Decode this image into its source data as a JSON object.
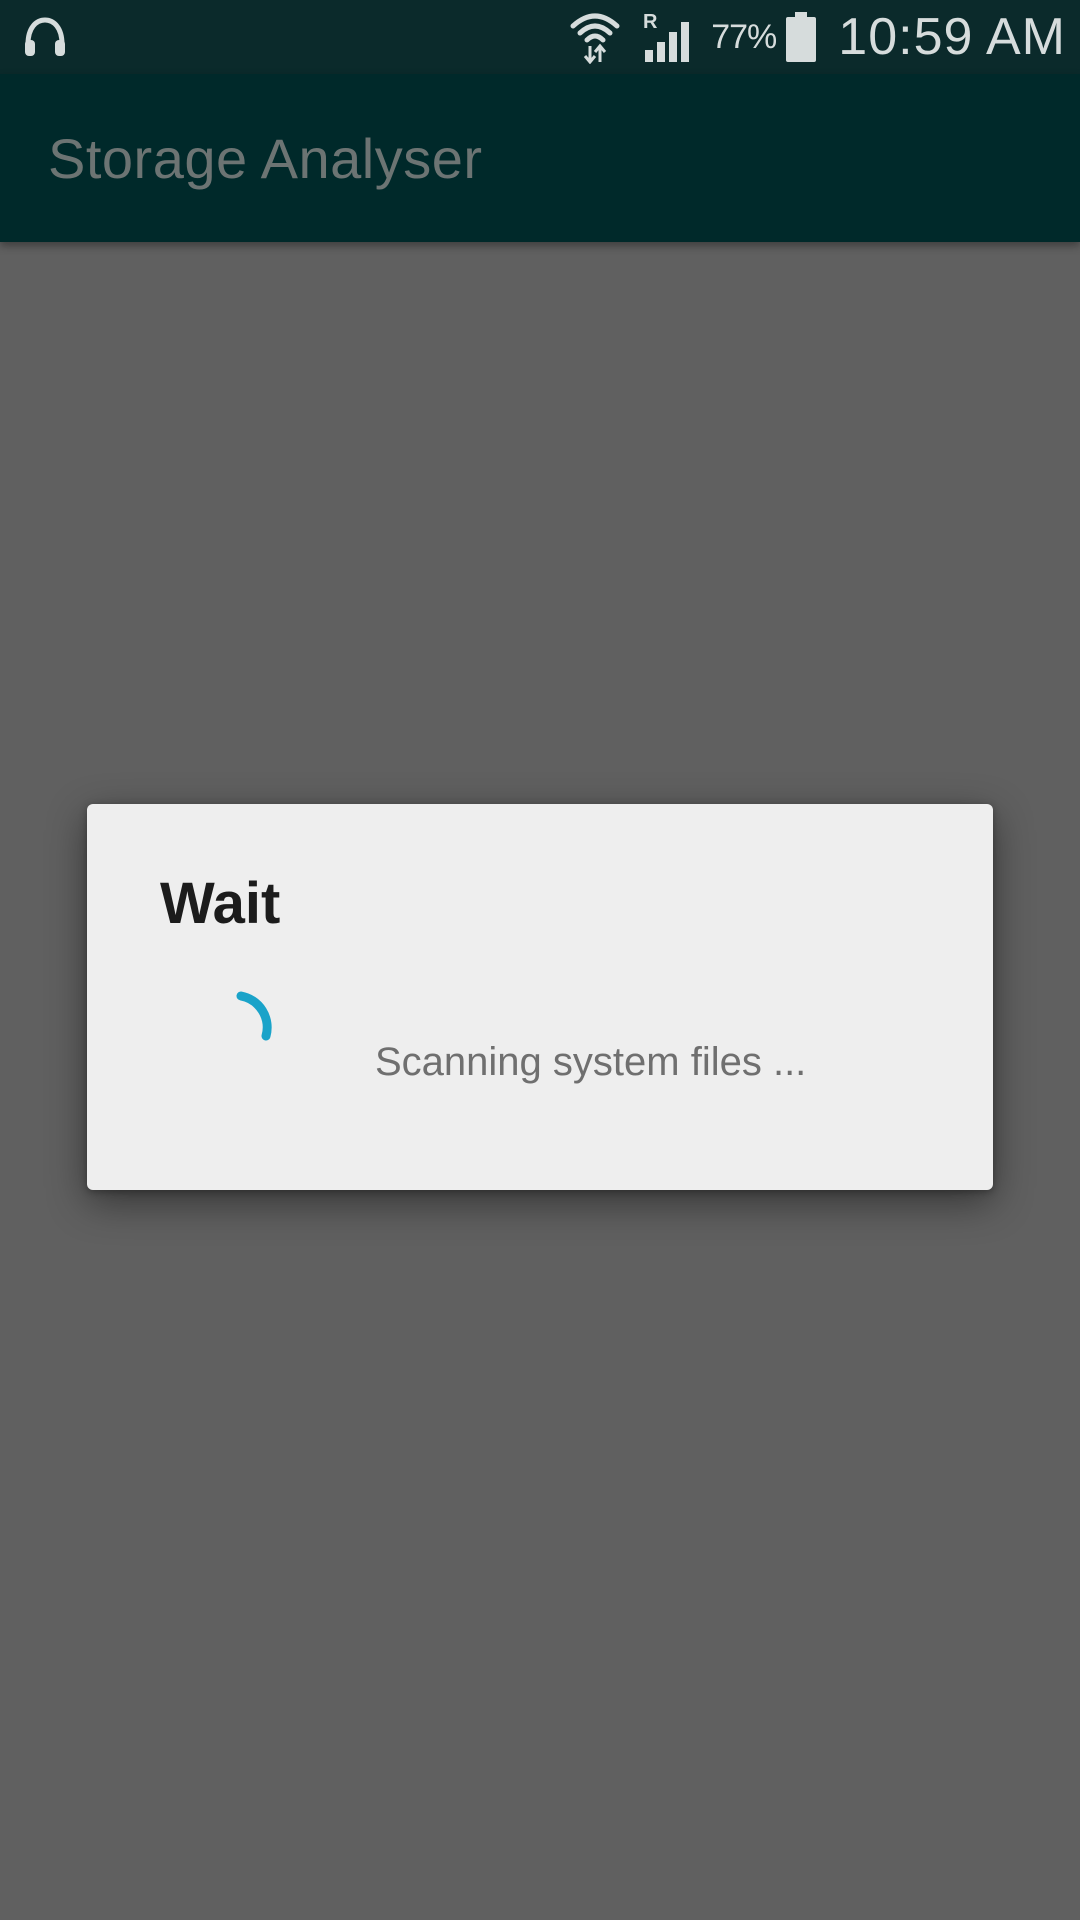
{
  "status_bar": {
    "left_icon": "headphones-icon",
    "wifi_icon": "wifi-icon",
    "signal_icon": "signal-roaming-icon",
    "signal_roaming_letter": "R",
    "battery_percent": "77%",
    "battery_icon": "battery-icon",
    "time": "10:59 AM"
  },
  "app_bar": {
    "title": "Storage Analyser"
  },
  "dialog": {
    "title": "Wait",
    "spinner_icon": "progress-spinner-icon",
    "message": "Scanning system files ...",
    "spinner_color": "#1aa3c9"
  },
  "colors": {
    "status_bar_bg": "#0b2a2b",
    "app_bar_bg": "#00292a",
    "scrim": "#606060",
    "dialog_bg": "#eeeeee"
  }
}
